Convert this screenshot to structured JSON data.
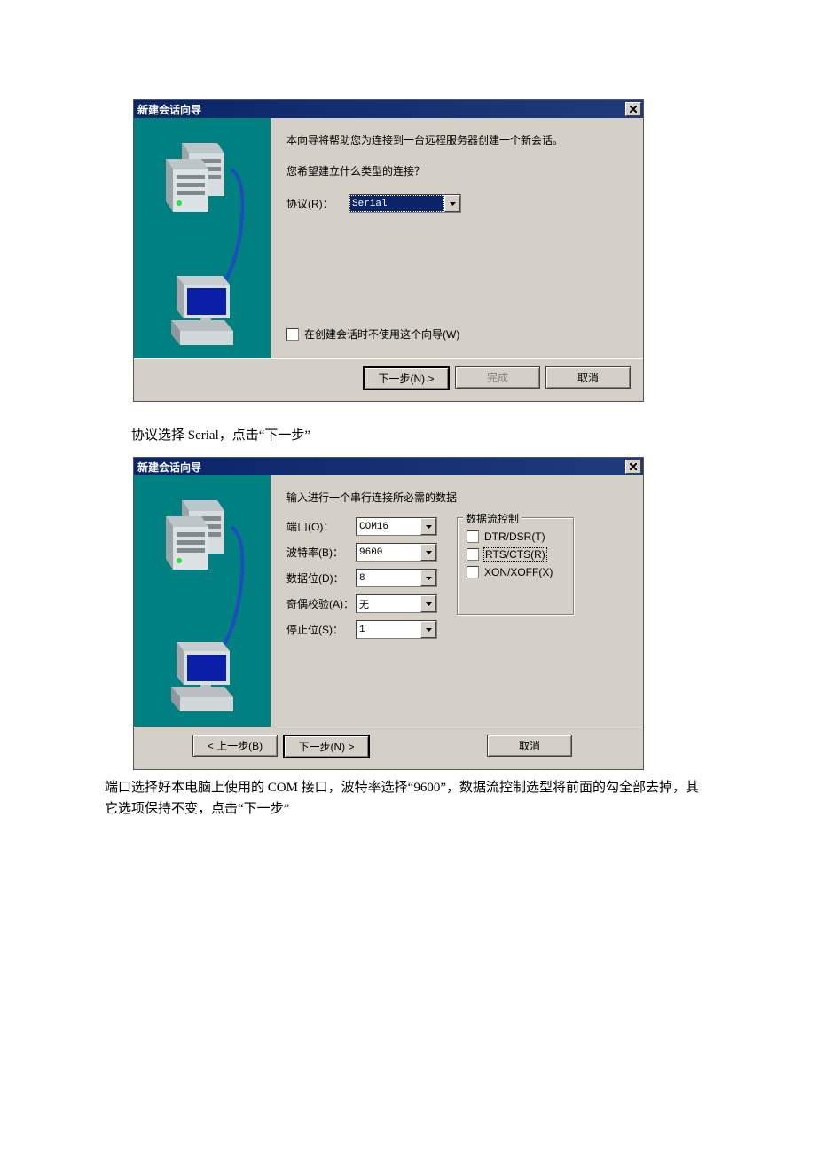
{
  "dialog1": {
    "title": "新建会话向导",
    "intro1": "本向导将帮助您为连接到一台远程服务器创建一个新会话。",
    "intro2": "您希望建立什么类型的连接？",
    "protocol_label": "协议(R)：",
    "protocol_value": "Serial",
    "dont_use_wizard": "在创建会话时不使用这个向导(W)",
    "next": "下一步(N) >",
    "finish": "完成",
    "cancel": "取消"
  },
  "caption1": "协议选择 Serial，点击“下一步”",
  "dialog2": {
    "title": "新建会话向导",
    "intro": "输入进行一个串行连接所必需的数据",
    "port_label": "端口(O)：",
    "port_value": "COM16",
    "baud_label": "波特率(B)：",
    "baud_value": "9600",
    "data_label": "数据位(D)：",
    "data_value": "8",
    "parity_label": "奇偶校验(A)：",
    "parity_value": "无",
    "stop_label": "停止位(S)：",
    "stop_value": "1",
    "flow_legend": "数据流控制",
    "dtrdsr": "DTR/DSR(T)",
    "rtscts": "RTS/CTS(R)",
    "xonxoff": "XON/XOFF(X)",
    "back": "< 上一步(B)",
    "next": "下一步(N) >",
    "cancel": "取消"
  },
  "caption2": "端口选择好本电脑上使用的 COM 接口，波特率选择“9600”，数据流控制选型将前面的勾全部去掉，其它选项保持不变，点击“下一步”"
}
